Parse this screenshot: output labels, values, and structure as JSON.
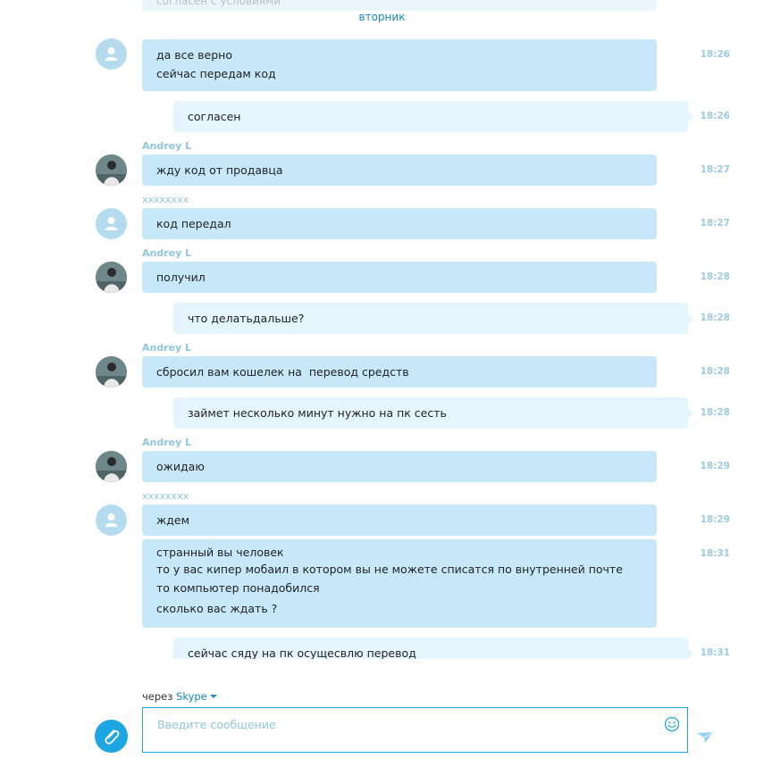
{
  "chat": {
    "day_separator": "вторник",
    "partial_top_text": "согласен с условиями",
    "messages": [
      {
        "lines": [
          "да все верно",
          "сейчас передам код"
        ],
        "time": "18:26"
      },
      {
        "lines": [
          "согласен"
        ],
        "time": "18:26"
      },
      {
        "sender": "Andrey L",
        "lines": [
          "жду код от продавца"
        ],
        "time": "18:27"
      },
      {
        "sender": "xxxxxxxx",
        "lines": [
          "код передал"
        ],
        "time": "18:27"
      },
      {
        "sender": "Andrey L",
        "lines": [
          "получил"
        ],
        "time": "18:28"
      },
      {
        "lines": [
          "что делатьдальше?"
        ],
        "time": "18:28"
      },
      {
        "sender": "Andrey L",
        "lines": [
          "сбросил вам кошелек на  перевод средств"
        ],
        "time": "18:28"
      },
      {
        "lines": [
          "займет несколько минут нужно на пк сесть"
        ],
        "time": "18:28"
      },
      {
        "sender": "Andrey L",
        "lines": [
          "ожидаю"
        ],
        "time": "18:29"
      },
      {
        "sender": "xxxxxxxx",
        "lines": [
          "ждем"
        ],
        "time": "18:29"
      },
      {
        "lines": [
          "странный вы человек",
          "то у вас кипер мобаил в котором вы не можете списатся по внутренней почте",
          "то компьютер понадобился",
          "сколько вас ждать ?"
        ],
        "time": "18:31"
      },
      {
        "lines": [
          "сейчас сяду на пк осущесвлю перевод"
        ],
        "time": "18:31"
      }
    ]
  },
  "composer": {
    "via_prefix": "через",
    "via_service": "Skype",
    "placeholder": "Введите сообщение",
    "value": ""
  },
  "icons": {
    "default_avatar": "user-silhouette-icon",
    "attach": "paperclip-icon",
    "emoji": "smiley-icon",
    "send": "paper-plane-icon"
  },
  "colors": {
    "accent": "#1ea6e3",
    "link": "#1a8bbb",
    "incoming_bubble": "#c7e8f9",
    "outgoing_bubble": "#e5f5fd",
    "sender_name": "#8fc6dc",
    "timestamp": "#9ccbe0"
  }
}
